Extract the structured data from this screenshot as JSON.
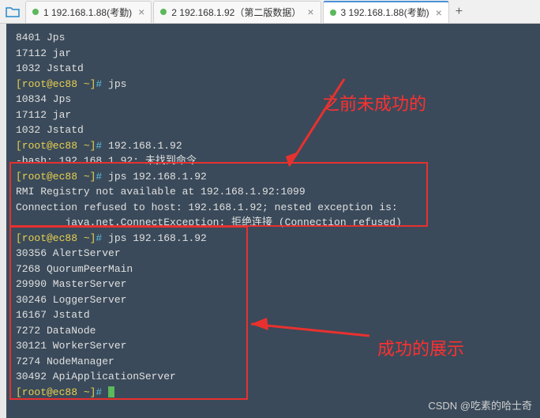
{
  "tabs": [
    {
      "label": "1 192.168.1.88(考勤)",
      "active": false
    },
    {
      "label": "2 192.168.1.92（第二版数据）",
      "active": false
    },
    {
      "label": "3 192.168.1.88(考勤)",
      "active": true
    }
  ],
  "terminal": {
    "lines": [
      {
        "text": "8401 Jps"
      },
      {
        "text": "17112 jar"
      },
      {
        "text": "1032 Jstatd"
      },
      {
        "prompt": true,
        "user": "[root@ec88 ~]",
        "symbol": "#",
        "cmd": " jps"
      },
      {
        "text": "10834 Jps"
      },
      {
        "text": "17112 jar"
      },
      {
        "text": "1032 Jstatd"
      },
      {
        "prompt": true,
        "user": "[root@ec88 ~]",
        "symbol": "#",
        "cmd": " 192.168.1.92"
      },
      {
        "text": "-bash: 192.168.1.92: 未找到命令"
      },
      {
        "prompt": true,
        "user": "[root@ec88 ~]",
        "symbol": "#",
        "cmd": " jps 192.168.1.92"
      },
      {
        "text": "RMI Registry not available at 192.168.1.92:1099"
      },
      {
        "text": "Connection refused to host: 192.168.1.92; nested exception is:"
      },
      {
        "text": "        java.net.ConnectException: 拒绝连接 (Connection refused)"
      },
      {
        "prompt": true,
        "user": "[root@ec88 ~]",
        "symbol": "#",
        "cmd": " jps 192.168.1.92"
      },
      {
        "text": "30356 AlertServer"
      },
      {
        "text": "7268 QuorumPeerMain"
      },
      {
        "text": "29990 MasterServer"
      },
      {
        "text": "30246 LoggerServer"
      },
      {
        "text": "16167 Jstatd"
      },
      {
        "text": "7272 DataNode"
      },
      {
        "text": "30121 WorkerServer"
      },
      {
        "text": "7274 NodeManager"
      },
      {
        "text": "30492 ApiApplicationServer"
      },
      {
        "prompt": true,
        "user": "[root@ec88 ~]",
        "symbol": "#",
        "cmd": " ",
        "cursor": true
      }
    ]
  },
  "annotations": {
    "label1": "之前未成功的",
    "label2": "成功的展示"
  },
  "watermark": "CSDN @吃素的哈士奇",
  "colors": {
    "bg": "#3a4a5a",
    "red": "#e8312f"
  }
}
